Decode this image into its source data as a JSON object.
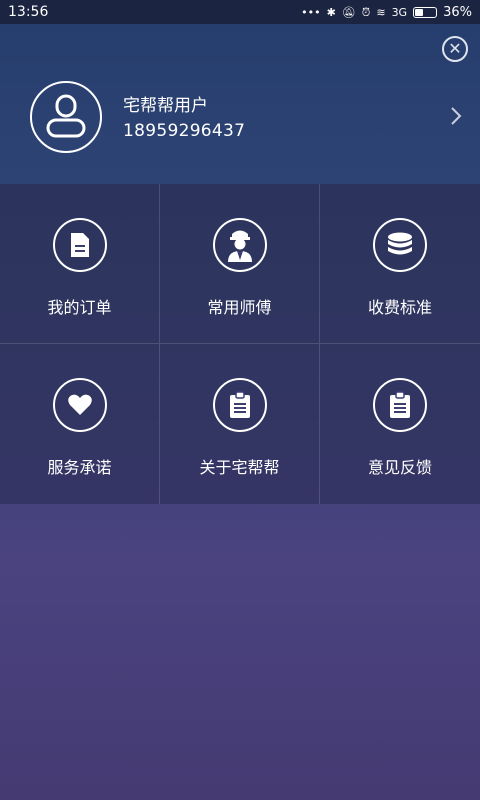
{
  "status_bar": {
    "time": "13:56",
    "signal": "3G",
    "battery": "36%"
  },
  "profile": {
    "name": "宅帮帮用户",
    "phone": "18959296437"
  },
  "menu": [
    {
      "label": "我的订单",
      "icon": "document-icon"
    },
    {
      "label": "常用师傅",
      "icon": "worker-icon"
    },
    {
      "label": "收费标准",
      "icon": "coins-icon"
    },
    {
      "label": "服务承诺",
      "icon": "heart-icon"
    },
    {
      "label": "关于宅帮帮",
      "icon": "clipboard-icon"
    },
    {
      "label": "意见反馈",
      "icon": "clipboard-icon"
    }
  ]
}
